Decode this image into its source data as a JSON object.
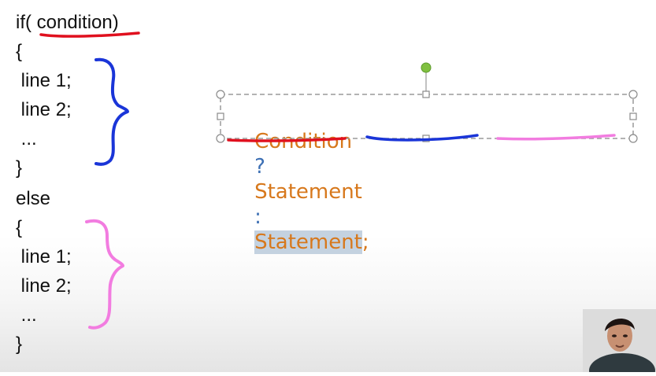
{
  "slide": {
    "code_lines": [
      "if( condition)",
      "{",
      " line 1;",
      " line 2;",
      " ...",
      "}",
      "else",
      "{",
      " line 1;",
      " line 2;",
      " ...",
      "}"
    ],
    "ternary": {
      "condition": "Condition",
      "question_mark": "?",
      "statement_true": "Statement",
      "colon": ":",
      "statement_false": "Statement",
      "semicolon": ";"
    }
  },
  "colors": {
    "code_text": "#111111",
    "ternary_orange": "#d7781c",
    "ternary_blue": "#3c6fb4",
    "annotation_red": "#e0101e",
    "annotation_blue": "#1a35d8",
    "annotation_pink": "#f27ce0",
    "selection_handle_green": "#80c040",
    "text_selection": "#c4d2e0"
  },
  "icons": {
    "presenter": "presenter-webcam-icon",
    "rotate_handle": "rotate-handle-icon"
  }
}
